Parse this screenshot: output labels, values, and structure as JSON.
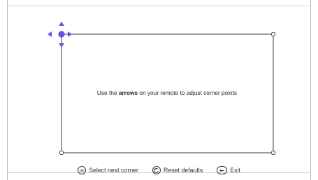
{
  "instruction": {
    "before": "Use the ",
    "bold": "arrows",
    "after": " on your remote to adjust corner points"
  },
  "bottom_hints": {
    "ok_glyph": "OK",
    "select": "Select next corner",
    "reset": "Reset defaults",
    "exit": "Exit"
  },
  "colors": {
    "accent": "#6b4fe0",
    "frame": "#3a3a3a",
    "edge": "#b9b9b9"
  },
  "icons": [
    "ok-icon",
    "reset-icon",
    "back-arrow-icon",
    "arrow-up-icon",
    "arrow-down-icon",
    "arrow-left-icon",
    "arrow-right-icon"
  ]
}
